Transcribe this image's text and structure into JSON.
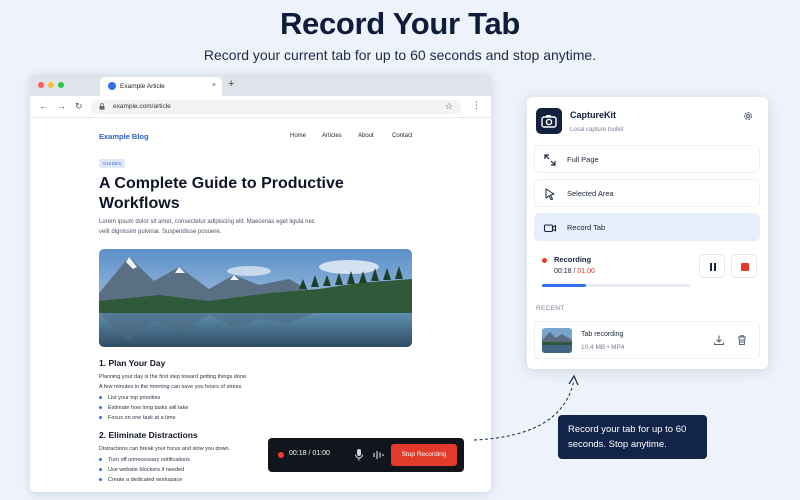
{
  "hero": {
    "title": "Record Your Tab",
    "subtitle": "Record your current tab for up to 60 seconds and stop anytime."
  },
  "browser": {
    "tab_title": "Example Article",
    "tab_close": "×",
    "new_tab": "+",
    "url": "example.com/article",
    "nav": {
      "back": "←",
      "forward": "→",
      "reload": "↻"
    },
    "bookmark": "☆",
    "menu": "⋮"
  },
  "article": {
    "site_name": "Example Blog",
    "nav_links": [
      "Home",
      "Articles",
      "About",
      "Contact"
    ],
    "badge": "GUIDES",
    "title": "A Complete Guide to Productive Workflows",
    "intro": "Lorem ipsum dolor sit amet, consectetur adipiscing elit. Maecenas eget ligula nec velit dignissim pulvinar. Suspendisse posuere.",
    "section1": {
      "heading": "1. Plan Your Day",
      "text1": "Planning your day is the first step toward getting things done.",
      "text2": "A few minutes in the morning can save you hours of stress.",
      "bullets": [
        "List your top priorities",
        "Estimate how long tasks will take",
        "Focus on one task at a time"
      ]
    },
    "section2": {
      "heading": "2. Eliminate Distractions",
      "text1": "Distractions can break your focus and slow you down.",
      "bullets": [
        "Turn off unnecessary notifications",
        "Use website blockers if needed",
        "Create a dedicated workspace"
      ]
    }
  },
  "recbar": {
    "time": "00:18 / 01:00",
    "stop_label": "Stop Recording"
  },
  "panel": {
    "app_name": "CaptureKit",
    "tagline": "Local capture toolkit",
    "modes": [
      "Full Page",
      "Selected Area",
      "Record Tab"
    ],
    "active_mode": "Record Tab",
    "recording": {
      "label": "Recording",
      "elapsed": "00:18",
      "separator": " / ",
      "total": "01:00",
      "progress": 0.3
    },
    "recent_label": "RECENT",
    "recent_items": [
      {
        "title": "Tab recording",
        "meta": "10.4 MB • MP4"
      }
    ]
  },
  "callout": {
    "text": "Record your tab for up to 60 seconds. Stop anytime."
  },
  "colors": {
    "accent": "#2f6ff0",
    "record_red": "#e23a2b",
    "navy": "#13244a"
  }
}
